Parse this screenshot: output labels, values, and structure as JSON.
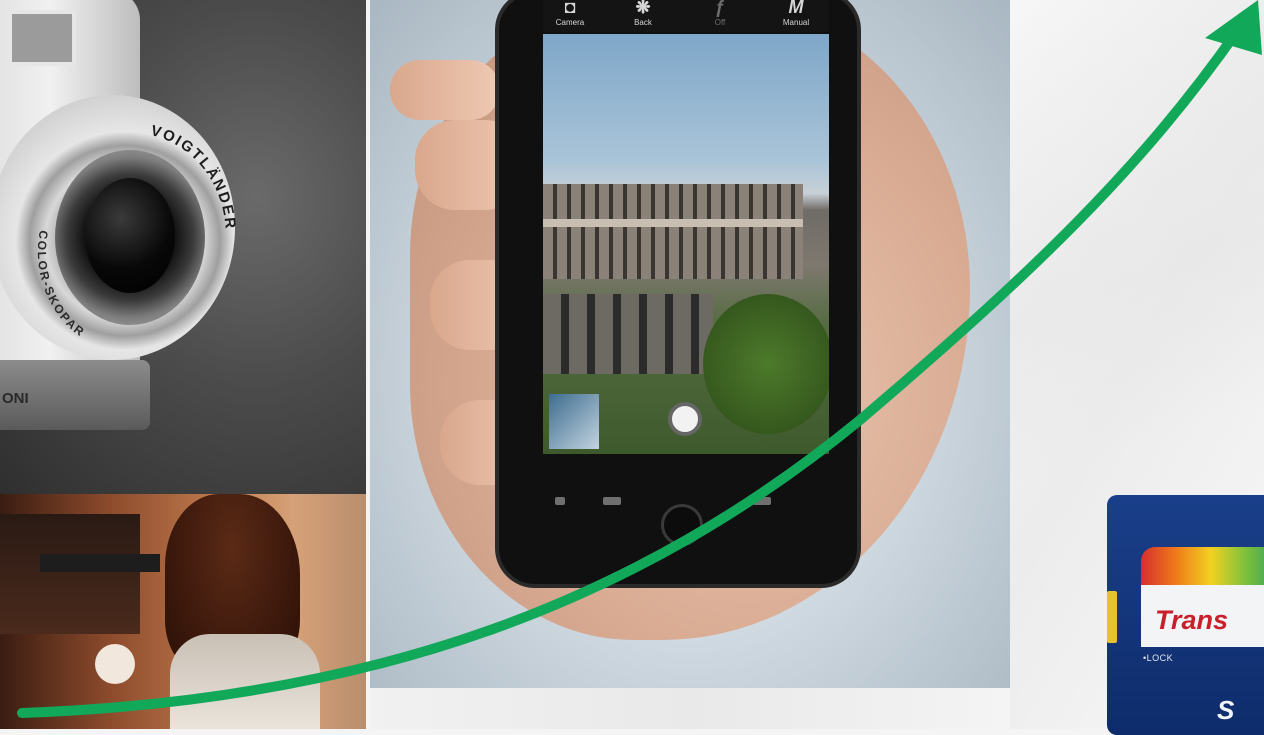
{
  "scene": {
    "camera": {
      "brand": "VOIGTLÄNDER",
      "lens_text": "COLOR-SKOPAR",
      "base_text": "ONI"
    },
    "phone": {
      "modes": [
        {
          "glyph": "◘",
          "label": "Camera"
        },
        {
          "glyph": "❋",
          "label": "Back"
        },
        {
          "glyph": "ƒ",
          "label": "Off"
        },
        {
          "glyph": "M",
          "label": "Manual"
        }
      ]
    },
    "sd_card": {
      "brand": "Trans",
      "lock": "•LOCK",
      "logo": "S"
    }
  },
  "colors": {
    "arrow": "#12a85a",
    "sd_blue": "#123a80",
    "sd_red": "#c8202b"
  },
  "icons": {
    "arrow": "arrow-up-right-icon",
    "shutter": "shutter-icon"
  }
}
